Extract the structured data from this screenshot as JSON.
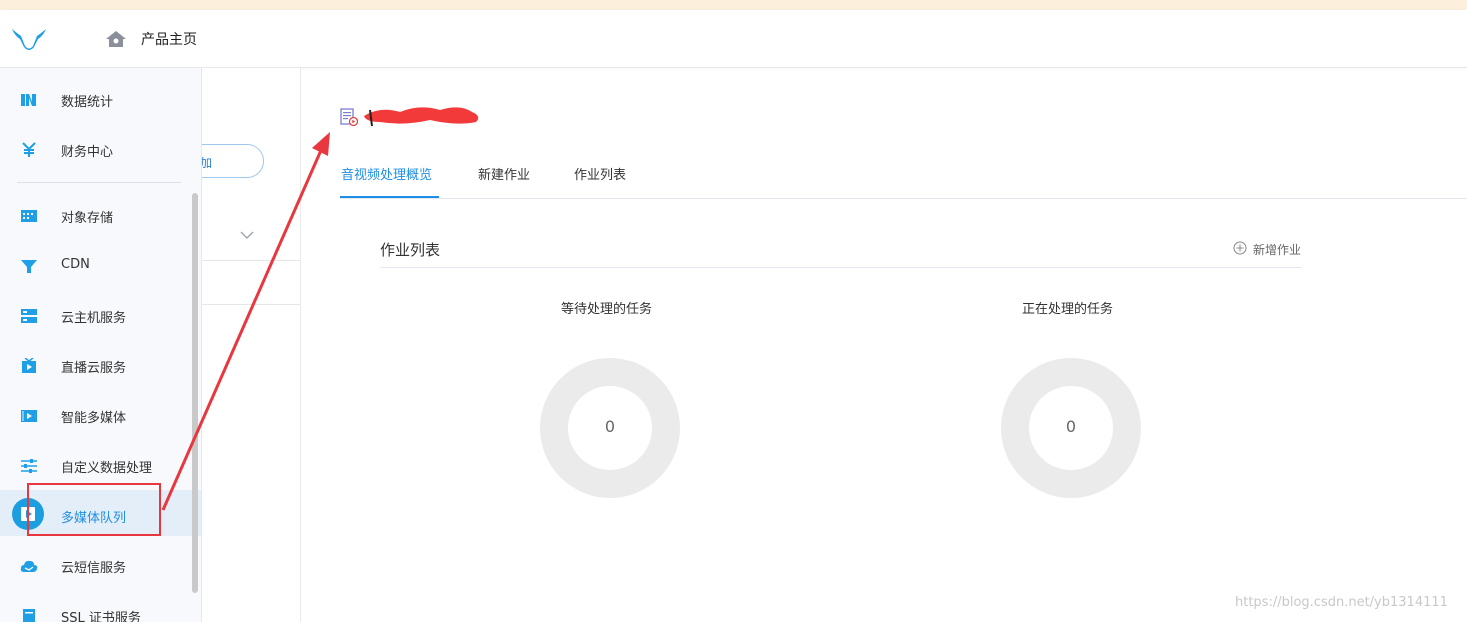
{
  "header": {
    "home_label": "产品主页"
  },
  "sidebar": {
    "items": [
      {
        "label": "数据统计",
        "icon": "stats-icon"
      },
      {
        "label": "财务中心",
        "icon": "yen-icon"
      },
      {
        "label": "对象存储",
        "icon": "storage-icon"
      },
      {
        "label": "CDN",
        "icon": "cdn-icon"
      },
      {
        "label": "云主机服务",
        "icon": "server-icon"
      },
      {
        "label": "直播云服务",
        "icon": "tv-icon"
      },
      {
        "label": "智能多媒体",
        "icon": "media-icon"
      },
      {
        "label": "自定义数据处理",
        "icon": "sliders-icon"
      },
      {
        "label": "多媒体队列",
        "icon": "play-icon",
        "active": true
      },
      {
        "label": "云短信服务",
        "icon": "cloud-sms-icon"
      },
      {
        "label": "SSL 证书服务",
        "icon": "certificate-icon"
      }
    ]
  },
  "underlay": {
    "pill_text": "加"
  },
  "tabs": [
    {
      "label": "音视频处理概览",
      "active": true
    },
    {
      "label": "新建作业"
    },
    {
      "label": "作业列表"
    }
  ],
  "card": {
    "title": "作业列表",
    "new_job_label": "新增作业"
  },
  "stats": [
    {
      "label": "等待处理的任务",
      "value": "0"
    },
    {
      "label": "正在处理的任务",
      "value": "0"
    }
  ],
  "watermark": "https://blog.csdn.net/yb1314111",
  "colors": {
    "accent": "#1f8ee6",
    "annotation_red": "#e8373e",
    "donut_ring": "#ebebeb"
  }
}
